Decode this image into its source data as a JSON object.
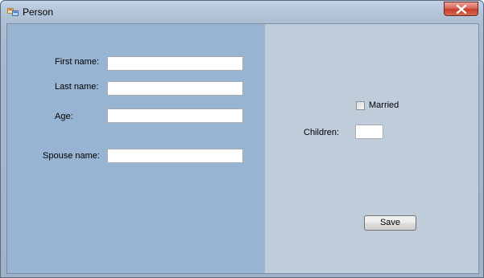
{
  "window": {
    "title": "Person",
    "icon": "form-icon",
    "close_icon": "close-icon",
    "accent_close": "#c53c2b"
  },
  "form": {
    "first_name_label": "First name:",
    "first_name_value": "",
    "last_name_label": "Last name:",
    "last_name_value": "",
    "age_label": "Age:",
    "age_value": "",
    "spouse_name_label": "Spouse name:",
    "spouse_name_value": "",
    "married_label": "Married",
    "married_checked": false,
    "children_label": "Children:",
    "children_value": "",
    "save_label": "Save"
  },
  "colors": {
    "left_panel": "#98b4d3",
    "right_panel": "#bfccda"
  }
}
